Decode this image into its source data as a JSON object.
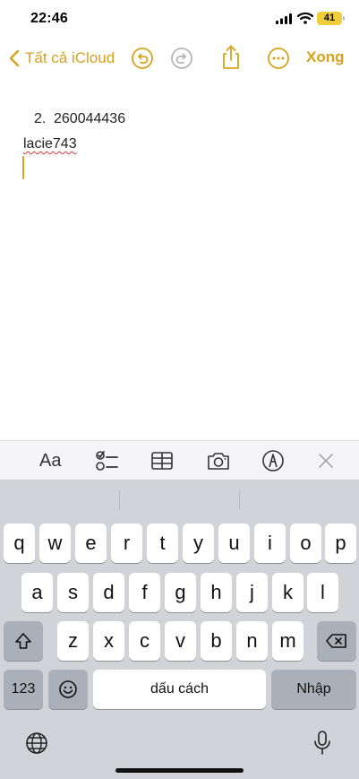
{
  "status": {
    "time": "22:46",
    "battery": "41"
  },
  "nav": {
    "back_label": "Tất cả iCloud",
    "done_label": "Xong"
  },
  "note": {
    "line1_number": "2.",
    "line1_text": "260044436",
    "line2_text": "lacie743"
  },
  "toolbar": {
    "format_label": "Aa"
  },
  "keyboard": {
    "row1": [
      "q",
      "w",
      "e",
      "r",
      "t",
      "y",
      "u",
      "i",
      "o",
      "p"
    ],
    "row2": [
      "a",
      "s",
      "d",
      "f",
      "g",
      "h",
      "j",
      "k",
      "l"
    ],
    "row3": [
      "z",
      "x",
      "c",
      "v",
      "b",
      "n",
      "m"
    ],
    "numbers_label": "123",
    "space_label": "dấu cách",
    "return_label": "Nhập"
  },
  "colors": {
    "accent": "#d8a21a",
    "keyboard_bg": "#d1d3d9"
  }
}
